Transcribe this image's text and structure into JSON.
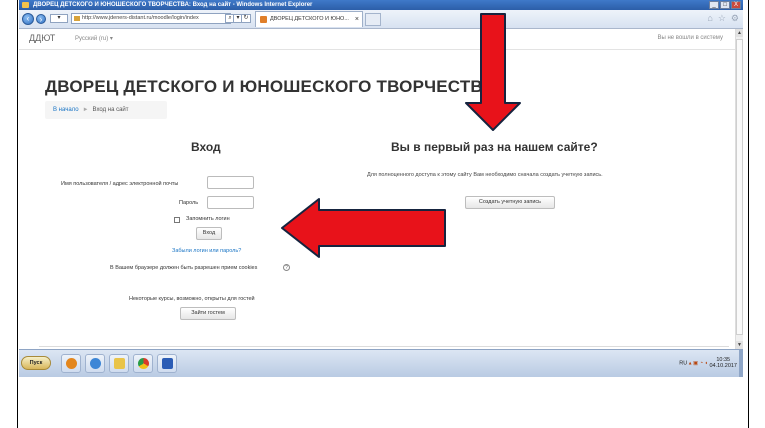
{
  "window": {
    "title": "ДВОРЕЦ ДЕТСКОГО И ЮНОШЕСКОГО ТВОРЧЕСТВА: Вход на сайт - Windows Internet Explorer",
    "controls": [
      "_",
      "□",
      "X"
    ]
  },
  "browser": {
    "address": "http://www.jdeners-distant.ru/moodle/login/index",
    "tab_label": "ДВОРЕЦ ДЕТСКОГО И ЮНО...",
    "tab_close": "×"
  },
  "moodle_nav": {
    "site_short": "ДДЮТ",
    "language": "Русский (ru) ▾",
    "not_logged_in": "Вы не вошли в систему"
  },
  "page": {
    "site_title": "ДВОРЕЦ ДЕТСКОГО И ЮНОШЕСКОГО ТВОРЧЕСТВА",
    "breadcrumb_home": "В начало",
    "breadcrumb_separator": "►",
    "breadcrumb_current": "Вход на сайт"
  },
  "login": {
    "heading": "Вход",
    "username_label": "Имя пользователя / адрес электронной почты",
    "password_label": "Пароль",
    "remember_label": "Запомнить логин",
    "login_button": "Вход",
    "forgot_link": "Забыли логин или пароль?",
    "cookies_note": "В Вашем браузере должен быть разрешен прием cookies",
    "help_icon_glyph": "?",
    "guest_note": "Некоторые курсы, возможно, открыты для гостей",
    "guest_button": "Зайти гостем"
  },
  "first_time": {
    "heading": "Вы в первый раз на нашем сайте?",
    "text": "Для полноценного доступа к этому сайту Вам необходимо сначала создать учетную запись.",
    "create_button": "Создать учетную запись"
  },
  "taskbar": {
    "start_label": "Пуск",
    "lang": "RU",
    "time": "10:35",
    "date": "04.10.2017"
  },
  "colors": {
    "link": "#1a75c5",
    "arrow": "#e8121a",
    "arrow_outline": "#16243f"
  }
}
